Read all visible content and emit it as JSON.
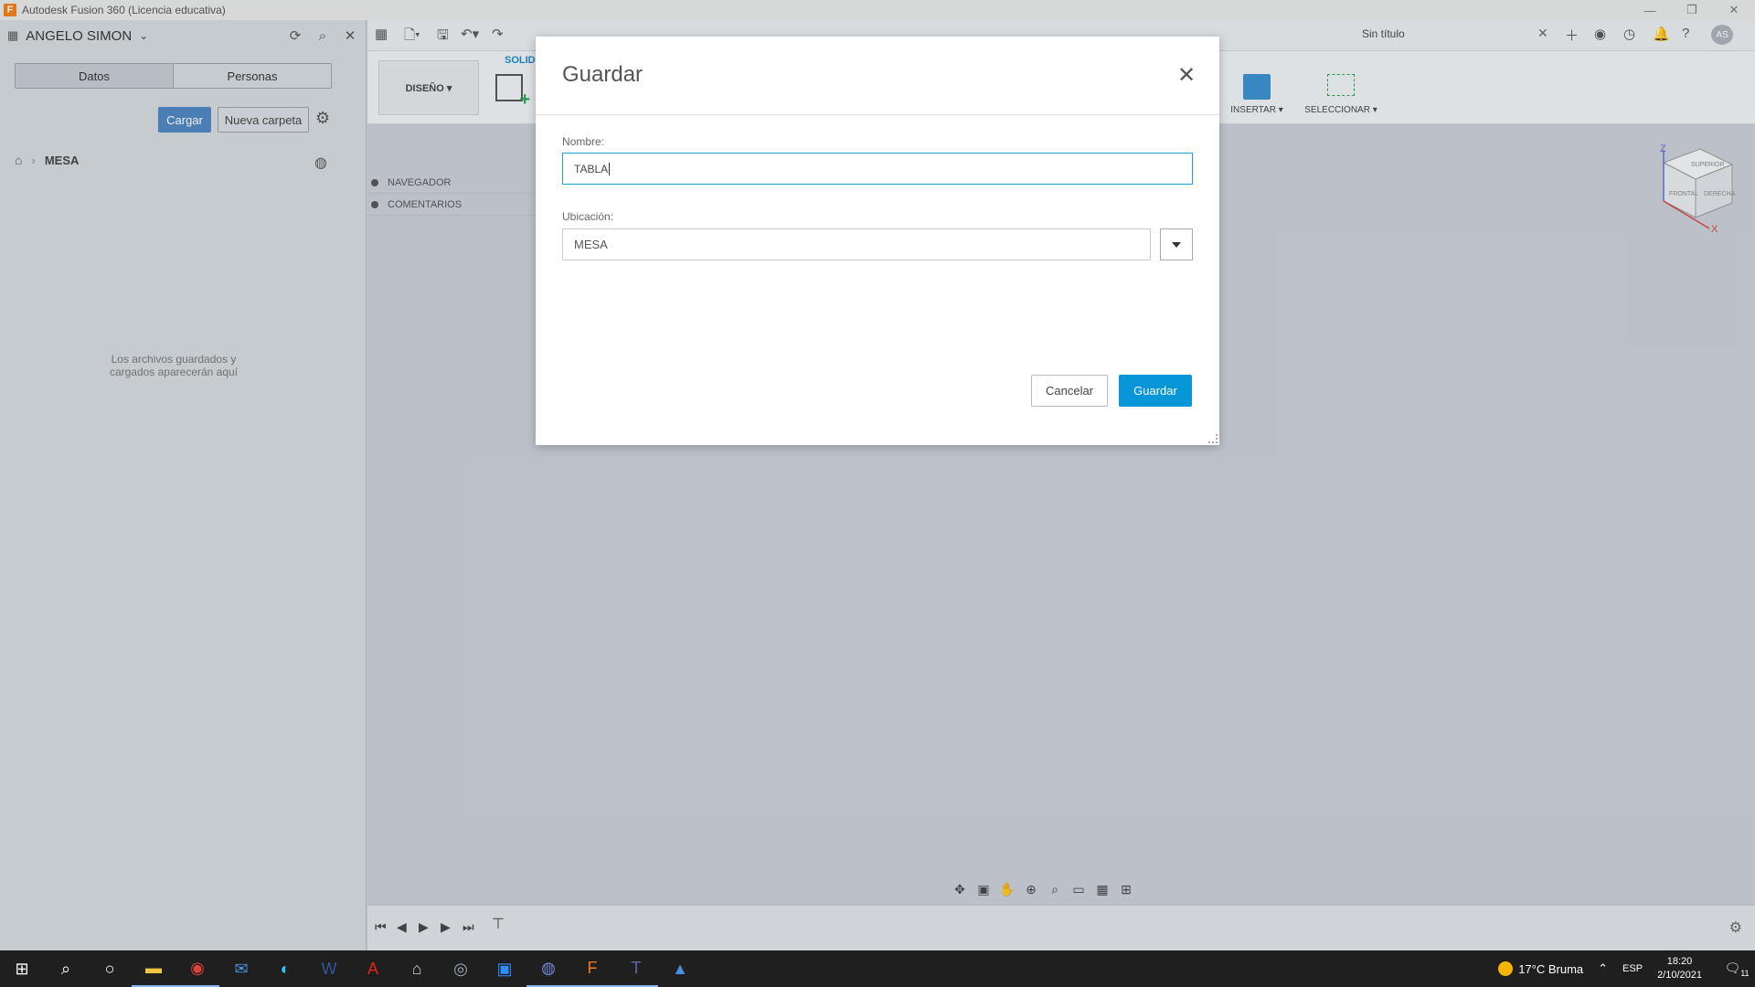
{
  "window": {
    "title": "Autodesk Fusion 360 (Licencia educativa)",
    "app_icon": "F"
  },
  "data_panel": {
    "user": "ANGELO SIMON",
    "tabs": [
      "Datos",
      "Personas"
    ],
    "upload_label": "Cargar",
    "new_folder_label": "Nueva carpeta",
    "breadcrumb_folder": "MESA",
    "empty_message": "Los archivos guardados y cargados aparecerán aquí"
  },
  "ribbon": {
    "workspace": "DISEÑO ▾",
    "active_tab": "SOLID",
    "insert_label": "INSERTAR ▾",
    "select_label": "SELECCIONAR ▾"
  },
  "toolbar": {
    "doc_tab": "Sin título",
    "user_initials": "AS"
  },
  "browser": {
    "items": [
      "NAVEGADOR",
      "COMENTARIOS"
    ]
  },
  "viewcube": {
    "faces": [
      "SUPERIOR",
      "FRONTAL",
      "DERECHA"
    ],
    "axes": [
      "Z",
      "X"
    ]
  },
  "dialog": {
    "title": "Guardar",
    "name_label": "Nombre:",
    "name_value": "TABLA",
    "location_label": "Ubicación:",
    "location_value": "MESA",
    "cancel_label": "Cancelar",
    "save_label": "Guardar"
  },
  "taskbar": {
    "weather": "17°C  Bruma",
    "language": "ESP",
    "time": "18:20",
    "date": "2/10/2021",
    "notification_count": "11"
  },
  "colors": {
    "primary": "#0696d7",
    "upload_button": "#4f85c1",
    "focus_border": "#1aa3d8",
    "taskbar": "#1f1f1f"
  }
}
